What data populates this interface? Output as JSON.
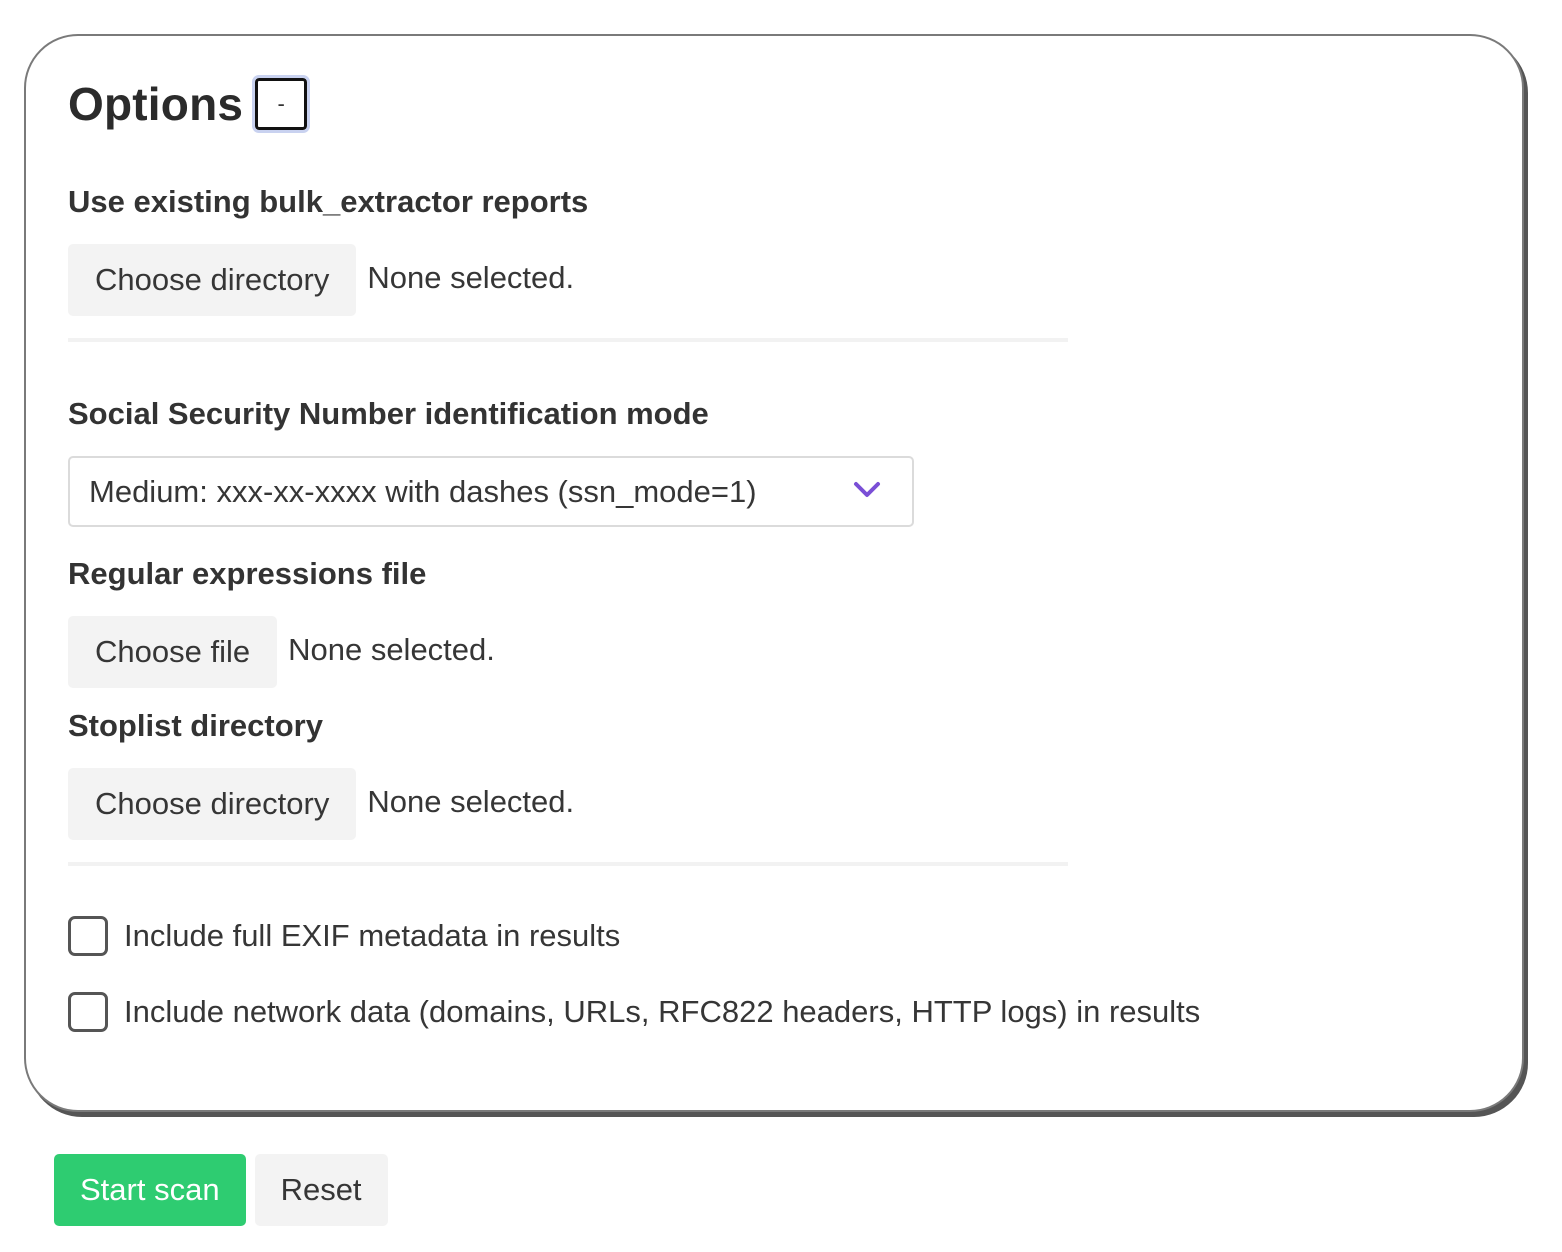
{
  "options": {
    "title": "Options",
    "collapse_label": "-",
    "reports": {
      "label": "Use existing bulk_extractor reports",
      "button_label": "Choose directory",
      "status": "None selected."
    },
    "ssn": {
      "label": "Social Security Number identification mode",
      "selected": "Medium: xxx-xx-xxxx with dashes (ssn_mode=1)",
      "chevron_icon": "chevron-down-icon",
      "chevron_color": "#7a4fd6"
    },
    "regex": {
      "label": "Regular expressions file",
      "button_label": "Choose file",
      "status": "None selected."
    },
    "stoplist": {
      "label": "Stoplist directory",
      "button_label": "Choose directory",
      "status": "None selected."
    },
    "checkboxes": [
      {
        "label": "Include full EXIF metadata in results",
        "checked": false
      },
      {
        "label": "Include network data (domains, URLs, RFC822 headers, HTTP logs) in results",
        "checked": false
      }
    ]
  },
  "actions": {
    "start_label": "Start scan",
    "start_color": "#2ecc71",
    "reset_label": "Reset"
  }
}
